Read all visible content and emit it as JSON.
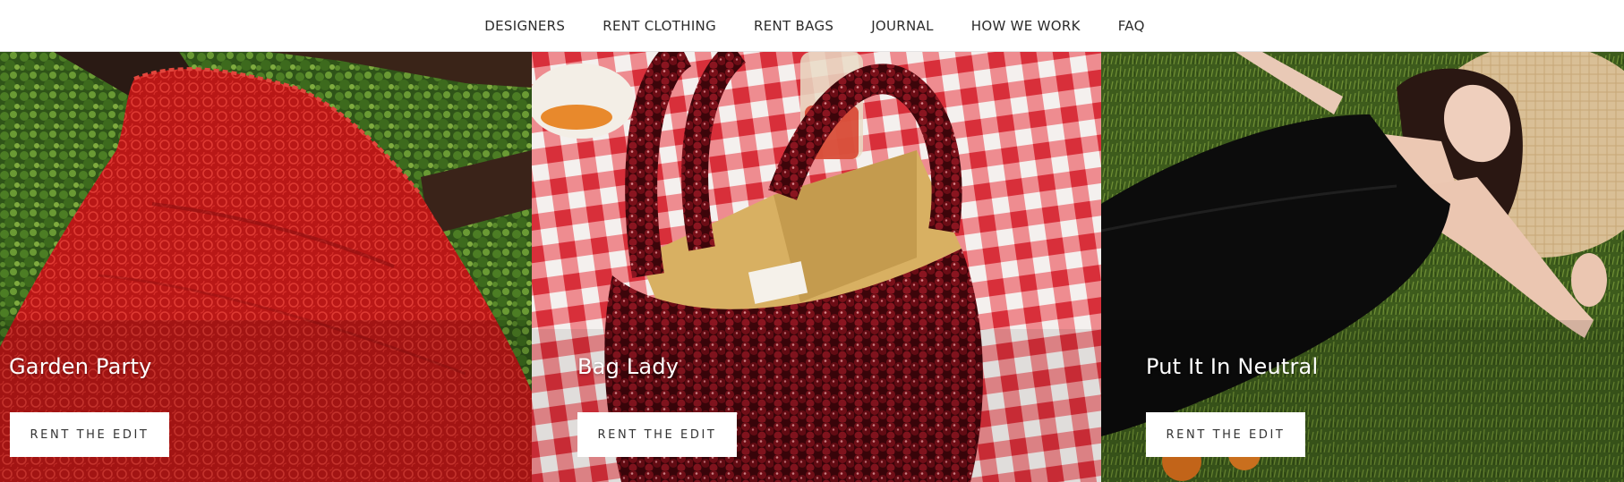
{
  "nav": {
    "items": [
      "DESIGNERS",
      "RENT CLOTHING",
      "RENT BAGS",
      "JOURNAL",
      "HOW WE WORK",
      "FAQ"
    ]
  },
  "panels": [
    {
      "title": "Garden Party",
      "cta": "RENT THE EDIT"
    },
    {
      "title": "Bag Lady",
      "cta": "RENT THE EDIT"
    },
    {
      "title": "Put It In Neutral",
      "cta": "RENT THE EDIT"
    }
  ],
  "colors": {
    "dress_red": "#c01c1a",
    "grass_green": "#3f6a22",
    "bag_burgundy": "#6a0d14",
    "gingham_red": "#e7414a",
    "dress_black": "#0d0d0d",
    "straw_hat": "#d8bf95"
  }
}
